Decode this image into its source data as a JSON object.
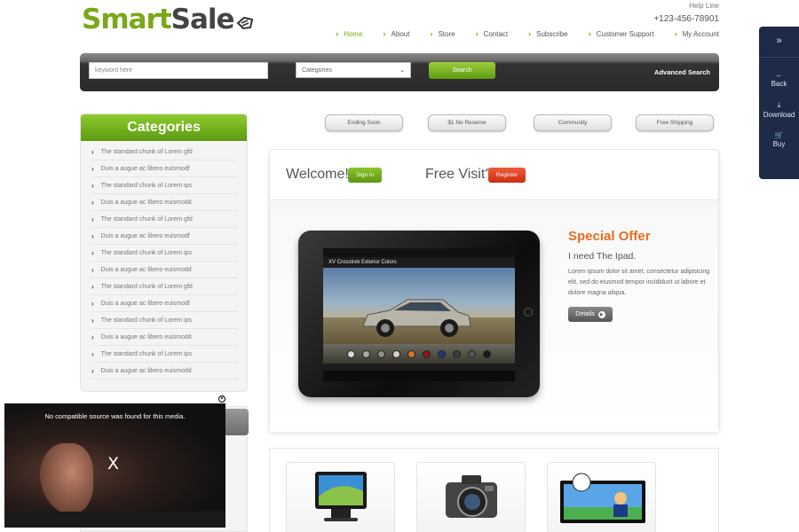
{
  "brand": {
    "smart": "Smart",
    "sale": "Sale"
  },
  "helpline": {
    "label": "Help Line",
    "phone": "+123-456-78901"
  },
  "nav": [
    {
      "label": "Home"
    },
    {
      "label": "About"
    },
    {
      "label": "Store"
    },
    {
      "label": "Contact"
    },
    {
      "label": "Subscribe"
    },
    {
      "label": "Customer Support"
    },
    {
      "label": "My Account"
    }
  ],
  "search": {
    "placeholder": "keyword here",
    "category_value": "Categories",
    "button": "Search",
    "advanced": "Advanced Search"
  },
  "categories": {
    "title": "Categories",
    "items": [
      "The standard chunk of Lorem gfd",
      "Duis a augue ac libero euismodf",
      "The standard chunk of Lorem ips",
      "Duis a augue ac libero euismodd",
      "The standard chunk of Lorem gfd",
      "Duis a augue ac libero euismodf",
      "The standard chunk of Lorem ips",
      "Duis a augue ac libero euismodd",
      "The standard chunk of Lorem gfd",
      "Duis a augue ac libero euismodf",
      "The standard chunk of Lorem ips",
      "Duis a augue ac libero euismodd",
      "The standard chunk of Lorem ips",
      "Duis a augue ac libero euismodd"
    ]
  },
  "filters": [
    "Ending Soon",
    "$1 No Reserve",
    "Community",
    "Free Shipping"
  ],
  "welcome": {
    "welcome": "Welcome!",
    "signin": "Sign in",
    "freevisit": "Free Visit?",
    "register": "Register"
  },
  "offer": {
    "title": "Special Offer",
    "subtitle": "I need The Ipad.",
    "text": "Lorem ipsum dolor sit amet, consectetur adipisicing elit, sed do eiusmod tempor incididunt ut labore et dolore magna aliqua.",
    "details": "Details"
  },
  "screen": {
    "title": "XV Crosstrek Exterior Colors",
    "swatch_colors": [
      "#d8d8d8",
      "#a9a9a9",
      "#8e8e8e",
      "#d0d2cf",
      "#d9731c",
      "#8b1a1a",
      "#1f3b78",
      "#3b3b3b",
      "#555555",
      "#1a1a1a"
    ]
  },
  "drawer": {
    "back": "Back",
    "download": "Download",
    "buy": "Buy"
  },
  "video": {
    "message": "No compatible source was found for this media.",
    "close_glyph": "X"
  },
  "colors": {
    "accent_green": "#7aa81b",
    "offer_orange": "#e86d1f",
    "register_red": "#cc2d12",
    "drawer_bg": "#1e2a47"
  }
}
